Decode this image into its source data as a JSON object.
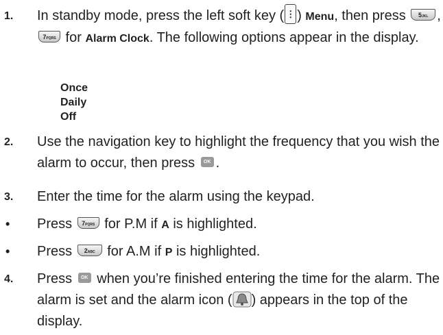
{
  "steps": [
    {
      "number": "1.",
      "text_a": "In standby mode, press the left soft key (",
      "text_b": ") ",
      "menu_label": "Menu",
      "text_c": ", then press ",
      "text_d": ", ",
      "text_e": " for ",
      "alarm_label": "Alarm Clock",
      "text_f": ". The following options appear in the display."
    },
    {
      "number": "2.",
      "text_a": "Use the navigation key to highlight the frequency that you wish the alarm to occur, then press ",
      "text_b": "."
    },
    {
      "number": "3.",
      "text": "Enter the time for the alarm using the keypad."
    },
    {
      "number": "4.",
      "text_a": "Press ",
      "text_b": " when you’re finished entering the time for the alarm. The alarm is set and the alarm icon (",
      "text_c": ") appears in the top of the display."
    }
  ],
  "options": [
    "Once",
    "Daily",
    "Off"
  ],
  "bullets": [
    {
      "symbol": "•",
      "text_a": "Press ",
      "text_b": " for P.M if ",
      "highlight": "A",
      "text_c": " is highlighted."
    },
    {
      "symbol": "•",
      "text_a": "Press ",
      "text_b": " for A.M if ",
      "highlight": "P",
      "text_c": " is highlighted."
    }
  ],
  "keys": {
    "softkey_glyph": "⋮",
    "five_digit": "5",
    "five_letters": "JKL",
    "seven_digit": "7",
    "seven_letters": "PQRS",
    "two_digit": "2",
    "two_letters": "ABC",
    "ok_label": "OK"
  },
  "icons": {
    "softkey": "menu-softkey-icon",
    "bell": "alarm-bell-icon",
    "ok": "ok-key-icon"
  }
}
